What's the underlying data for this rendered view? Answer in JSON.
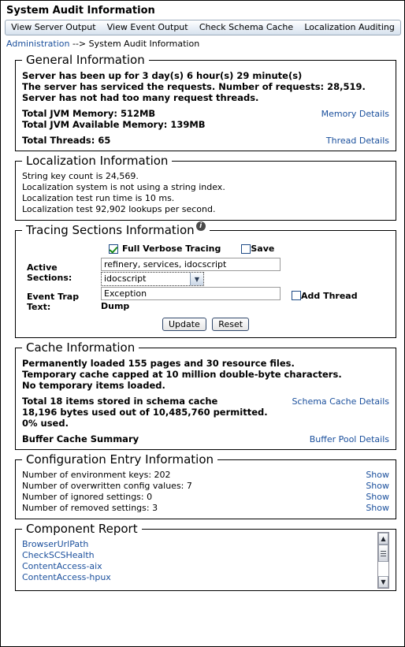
{
  "page": {
    "title": "System Audit Information"
  },
  "tabs": [
    {
      "label": "View Server Output"
    },
    {
      "label": "View Event Output"
    },
    {
      "label": "Check Schema Cache"
    },
    {
      "label": "Localization Auditing"
    }
  ],
  "breadcrumb": {
    "root": "Administration",
    "separator": " --> ",
    "current": "System Audit Information"
  },
  "general": {
    "legend": "General Information",
    "uptime": "Server has been up for 3 day(s) 6 hour(s) 29 minute(s)",
    "requests": "The server has serviced the requests. Number of requests: 28,519.",
    "threads_status": "Server has not had too many request threads.",
    "total_jvm_memory": "Total JVM Memory: 512MB",
    "memory_details_link": "Memory Details",
    "available_jvm_memory": "Total JVM Available Memory: 139MB",
    "total_threads": "Total Threads: 65",
    "thread_details_link": "Thread Details"
  },
  "localization": {
    "legend": "Localization Information",
    "lines": [
      "String key count is 24,569.",
      "Localization system is not using a string index.",
      "Localization test run time is 10 ms.",
      "Localization test 92,902 lookups per second."
    ]
  },
  "tracing": {
    "legend": "Tracing Sections Information",
    "info_icon": "info-icon",
    "full_verbose_label": "Full Verbose Tracing",
    "full_verbose_checked": true,
    "save_label": "Save",
    "save_checked": false,
    "active_sections_label": "Active Sections:",
    "active_sections_value": "refinery, services, idocscript",
    "section_select_value": "idocscript",
    "section_select_options": [
      "idocscript"
    ],
    "event_trap_label_line1": "Event Trap",
    "event_trap_label_line2": "Text:",
    "event_trap_value": "Exception",
    "dump_label": "Dump",
    "add_thread_label": "Add Thread",
    "add_thread_checked": false,
    "update_button": "Update",
    "reset_button": "Reset"
  },
  "cache": {
    "legend": "Cache Information",
    "permanently_loaded": "Permanently loaded 155 pages and 30 resource files.",
    "temp_cache_cap": "Temporary cache capped at 10 million double-byte characters.",
    "no_temp_items": "No temporary items loaded.",
    "schema_items": "Total 18 items stored in schema cache",
    "schema_cache_details_link": "Schema Cache Details",
    "schema_bytes": "18,196 bytes used out of 10,485,760 permitted.",
    "schema_percent": "0% used.",
    "buffer_summary": "Buffer Cache Summary",
    "buffer_pool_details_link": "Buffer Pool Details"
  },
  "config": {
    "legend": "Configuration Entry Information",
    "rows": [
      {
        "text": "Number of environment keys: 202",
        "link": "Show"
      },
      {
        "text": "Number of overwritten config values: 7",
        "link": "Show"
      },
      {
        "text": "Number of ignored settings: 0",
        "link": "Show"
      },
      {
        "text": "Number of removed settings: 3",
        "link": "Show"
      }
    ]
  },
  "component_report": {
    "legend": "Component Report",
    "items": [
      "BrowserUrlPath",
      "CheckSCSHealth",
      "ContentAccess-aix",
      "ContentAccess-hpux"
    ],
    "scroll_up_icon": "chevron-up-icon",
    "scroll_down_icon": "chevron-down-icon"
  },
  "colors": {
    "link": "#1a4f9c",
    "check": "#1a8a1a",
    "border": "#000000"
  }
}
